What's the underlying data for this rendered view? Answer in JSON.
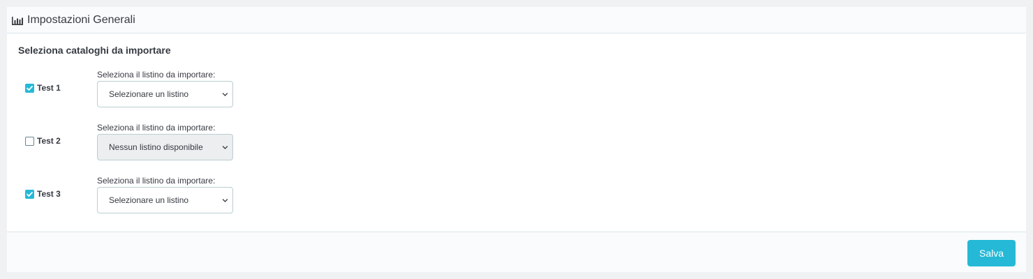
{
  "header": {
    "icon": "bar-chart-icon",
    "title": "Impostazioni Generali"
  },
  "section": {
    "title": "Seleziona cataloghi da importare"
  },
  "catalogs": [
    {
      "label": "Test 1",
      "checked": true,
      "select_label": "Seleziona il listino da importare:",
      "select_value": "Selezionare un listino",
      "disabled": false
    },
    {
      "label": "Test 2",
      "checked": false,
      "select_label": "Seleziona il listino da importare:",
      "select_value": "Nessun listino disponibile",
      "disabled": true
    },
    {
      "label": "Test 3",
      "checked": true,
      "select_label": "Seleziona il listino da importare:",
      "select_value": "Selezionare un listino",
      "disabled": false
    }
  ],
  "footer": {
    "save_label": "Salva"
  },
  "colors": {
    "accent": "#25b9d7",
    "text": "#363a41",
    "border": "#bbcdd2",
    "disabled_bg": "#eceeef"
  }
}
